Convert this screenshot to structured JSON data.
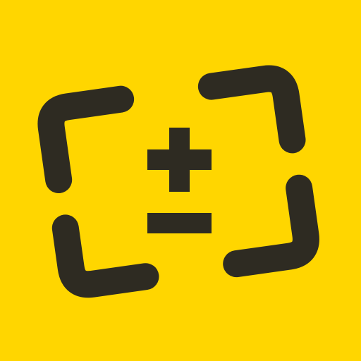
{
  "icon": {
    "name": "scan-calculator-icon",
    "background_color": "#FFD600",
    "foreground_color": "#2E2B22",
    "elements": {
      "frame": "viewfinder-corners",
      "symbol_top": "plus-sign",
      "symbol_bottom": "minus-sign"
    }
  }
}
